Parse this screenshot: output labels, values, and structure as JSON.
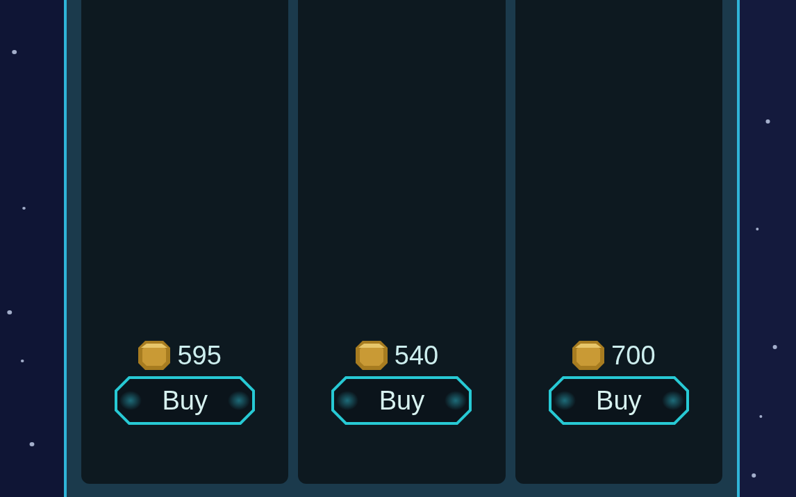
{
  "items": [
    {
      "price": "595",
      "button": "Buy"
    },
    {
      "price": "540",
      "button": "Buy"
    },
    {
      "price": "700",
      "button": "Buy"
    }
  ]
}
